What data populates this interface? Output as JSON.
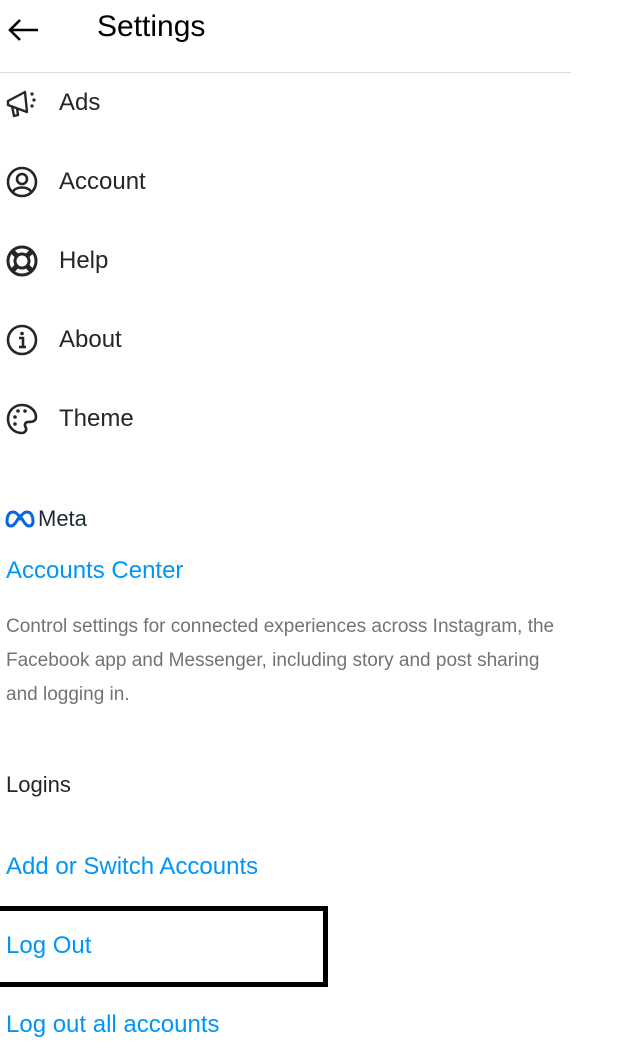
{
  "header": {
    "title": "Settings",
    "back_icon": "arrow-left-icon"
  },
  "menu": [
    {
      "label": "Ads",
      "icon": "megaphone-icon"
    },
    {
      "label": "Account",
      "icon": "account-circle-icon"
    },
    {
      "label": "Help",
      "icon": "lifebuoy-icon"
    },
    {
      "label": "About",
      "icon": "info-icon"
    },
    {
      "label": "Theme",
      "icon": "palette-icon"
    }
  ],
  "meta": {
    "wordmark": "Meta",
    "accounts_center": "Accounts Center",
    "description": "Control settings for connected experiences across Instagram, the Facebook app and Messenger, including story and post sharing and logging in."
  },
  "logins": {
    "title": "Logins",
    "items": [
      "Add or Switch Accounts",
      "Log Out",
      "Log out all accounts"
    ]
  },
  "colors": {
    "link": "#0095f6",
    "meta_blue": "#0668e1",
    "text": "#262626",
    "secondary": "#737373"
  }
}
